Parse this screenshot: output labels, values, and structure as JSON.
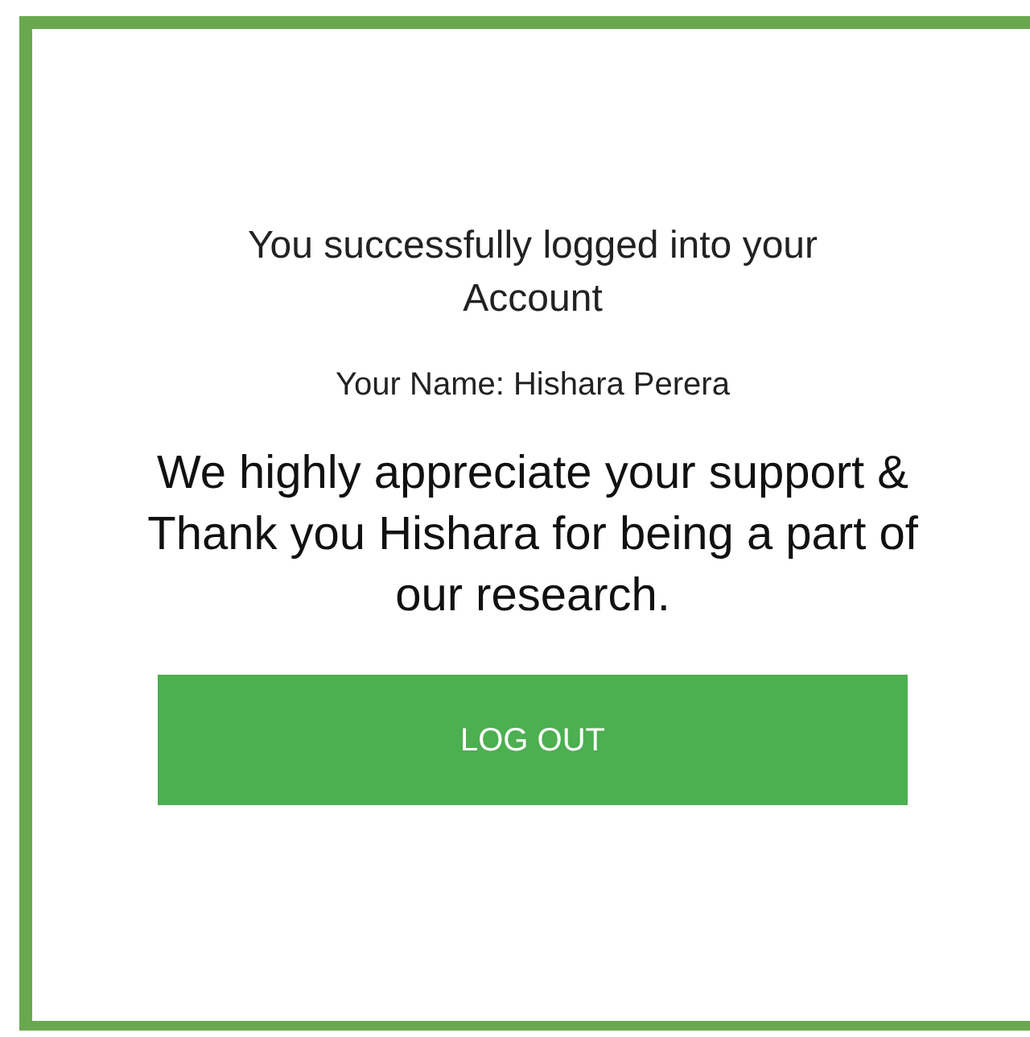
{
  "message": {
    "title": "You successfully logged into your Account",
    "name_line": "Your Name: Hishara Perera",
    "thanks": "We highly appreciate your support & Thank you Hishara for being a part of our research."
  },
  "button": {
    "label": "LOG OUT"
  }
}
